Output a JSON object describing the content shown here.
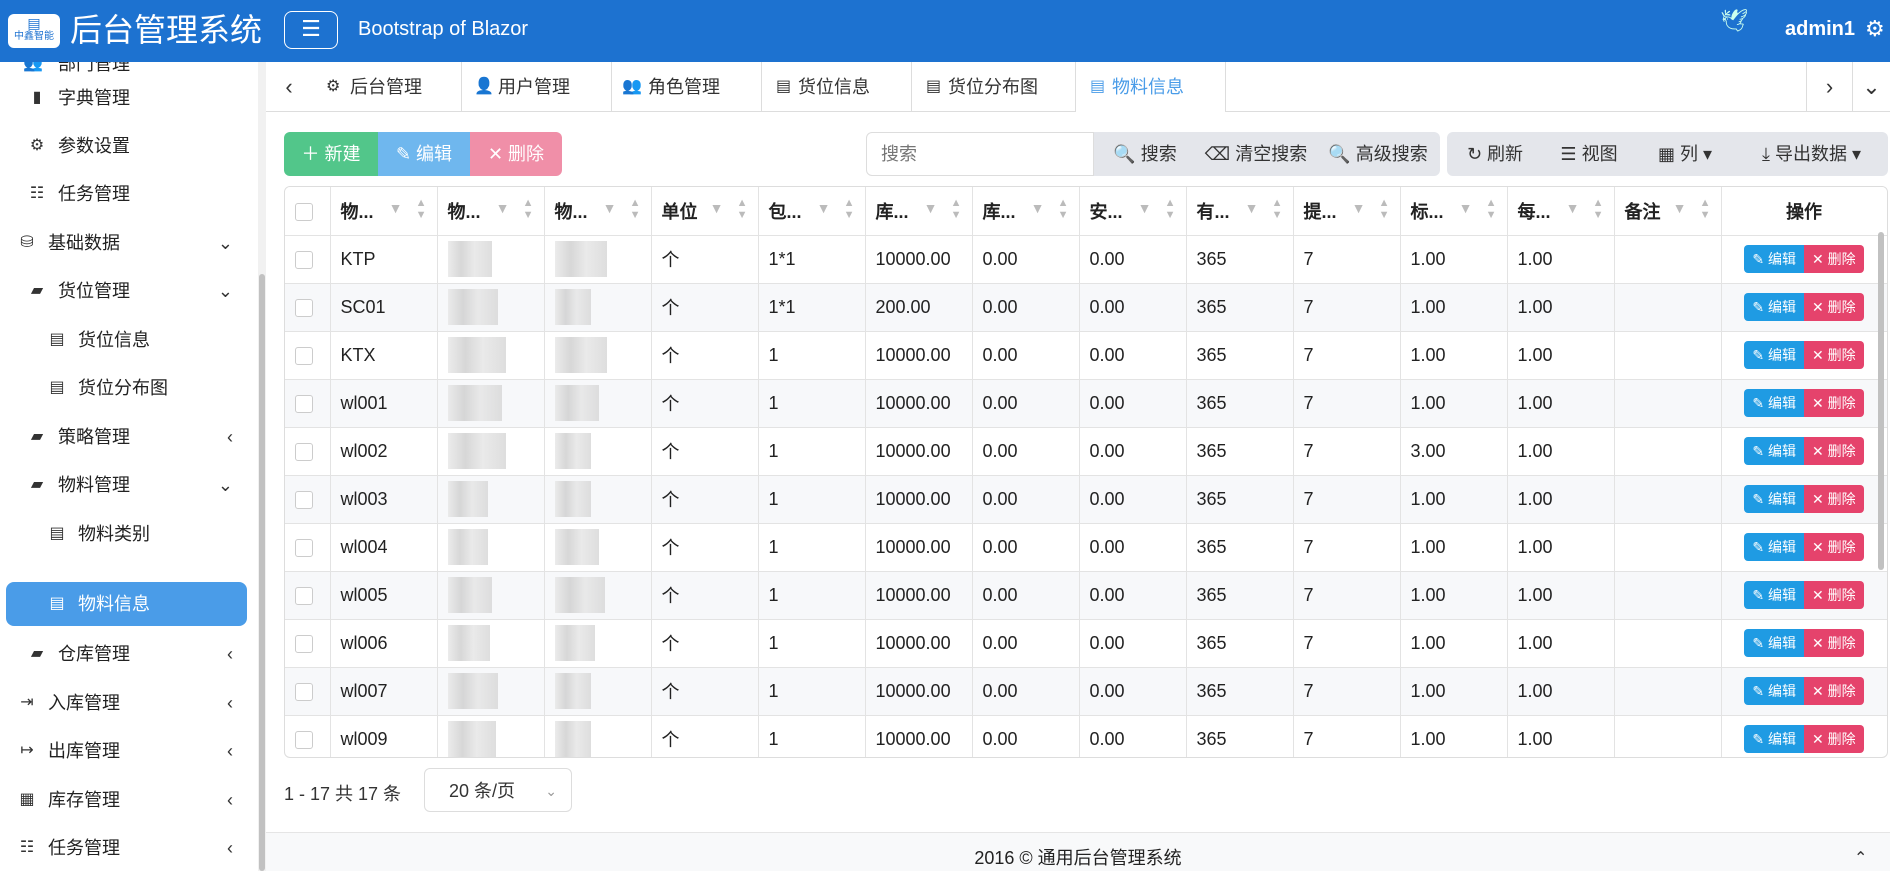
{
  "header": {
    "logo_text": "中鑫智能",
    "app_title": "后台管理系统",
    "menu_icon": "hamburger-icon",
    "brand_subtitle": "Bootstrap of Blazor",
    "user_name": "admin1",
    "settings_icon": "gear-icon"
  },
  "sidebar": {
    "items": [
      {
        "label": "部门管理",
        "icon": "users-icon"
      },
      {
        "label": "字典管理",
        "icon": "book-icon"
      },
      {
        "label": "参数设置",
        "icon": "gears-icon"
      },
      {
        "label": "任务管理",
        "icon": "list-icon"
      },
      {
        "label": "基础数据",
        "icon": "database-icon"
      },
      {
        "label": "货位管理",
        "icon": "folder-icon"
      },
      {
        "label": "货位信息",
        "icon": "file-icon"
      },
      {
        "label": "货位分布图",
        "icon": "file-icon"
      },
      {
        "label": "策略管理",
        "icon": "folder-icon"
      },
      {
        "label": "物料管理",
        "icon": "folder-icon"
      },
      {
        "label": "物料类别",
        "icon": "file-icon"
      },
      {
        "label": "物料信息",
        "icon": "file-icon"
      },
      {
        "label": "仓库管理",
        "icon": "folder-icon"
      },
      {
        "label": "入库管理",
        "icon": "sign-in-icon"
      },
      {
        "label": "出库管理",
        "icon": "sign-out-icon"
      },
      {
        "label": "库存管理",
        "icon": "cubes-icon"
      },
      {
        "label": "任务管理",
        "icon": "list-icon"
      }
    ]
  },
  "tabs": [
    {
      "label": "后台管理",
      "icon": "gear-icon"
    },
    {
      "label": "用户管理",
      "icon": "user-gear-icon"
    },
    {
      "label": "角色管理",
      "icon": "users-icon"
    },
    {
      "label": "货位信息",
      "icon": "file-icon"
    },
    {
      "label": "货位分布图",
      "icon": "file-icon"
    },
    {
      "label": "物料信息",
      "icon": "file-icon"
    }
  ],
  "toolbar": {
    "new_label": "新建",
    "edit_label": "编辑",
    "delete_label": "删除",
    "search_placeholder": "搜索",
    "search_label": "搜索",
    "clear_search_label": "清空搜索",
    "advanced_search_label": "高级搜索",
    "refresh_label": "刷新",
    "view_label": "视图",
    "columns_label": "列",
    "export_label": "导出数据"
  },
  "table": {
    "headers": [
      "物...",
      "物...",
      "物...",
      "单位",
      "包...",
      "库...",
      "库...",
      "安...",
      "有...",
      "提...",
      "标...",
      "每...",
      "备注",
      "操作"
    ],
    "row_edit_label": "编辑",
    "row_delete_label": "删除",
    "rows": [
      {
        "code": "KTP",
        "unit": "个",
        "pack": "1*1",
        "stock": "10000.00",
        "c5": "0.00",
        "c6": "0.00",
        "c7": "365",
        "c8": "7",
        "c9": "1.00",
        "c10": "1.00",
        "note": ""
      },
      {
        "code": "SC01",
        "unit": "个",
        "pack": "1*1",
        "stock": "200.00",
        "c5": "0.00",
        "c6": "0.00",
        "c7": "365",
        "c8": "7",
        "c9": "1.00",
        "c10": "1.00",
        "note": ""
      },
      {
        "code": "KTX",
        "unit": "个",
        "pack": "1",
        "stock": "10000.00",
        "c5": "0.00",
        "c6": "0.00",
        "c7": "365",
        "c8": "7",
        "c9": "1.00",
        "c10": "1.00",
        "note": ""
      },
      {
        "code": "wl001",
        "unit": "个",
        "pack": "1",
        "stock": "10000.00",
        "c5": "0.00",
        "c6": "0.00",
        "c7": "365",
        "c8": "7",
        "c9": "1.00",
        "c10": "1.00",
        "note": ""
      },
      {
        "code": "wl002",
        "unit": "个",
        "pack": "1",
        "stock": "10000.00",
        "c5": "0.00",
        "c6": "0.00",
        "c7": "365",
        "c8": "7",
        "c9": "3.00",
        "c10": "1.00",
        "note": ""
      },
      {
        "code": "wl003",
        "unit": "个",
        "pack": "1",
        "stock": "10000.00",
        "c5": "0.00",
        "c6": "0.00",
        "c7": "365",
        "c8": "7",
        "c9": "1.00",
        "c10": "1.00",
        "note": ""
      },
      {
        "code": "wl004",
        "unit": "个",
        "pack": "1",
        "stock": "10000.00",
        "c5": "0.00",
        "c6": "0.00",
        "c7": "365",
        "c8": "7",
        "c9": "1.00",
        "c10": "1.00",
        "note": ""
      },
      {
        "code": "wl005",
        "unit": "个",
        "pack": "1",
        "stock": "10000.00",
        "c5": "0.00",
        "c6": "0.00",
        "c7": "365",
        "c8": "7",
        "c9": "1.00",
        "c10": "1.00",
        "note": ""
      },
      {
        "code": "wl006",
        "unit": "个",
        "pack": "1",
        "stock": "10000.00",
        "c5": "0.00",
        "c6": "0.00",
        "c7": "365",
        "c8": "7",
        "c9": "1.00",
        "c10": "1.00",
        "note": ""
      },
      {
        "code": "wl007",
        "unit": "个",
        "pack": "1",
        "stock": "10000.00",
        "c5": "0.00",
        "c6": "0.00",
        "c7": "365",
        "c8": "7",
        "c9": "1.00",
        "c10": "1.00",
        "note": ""
      },
      {
        "code": "wl009",
        "unit": "个",
        "pack": "1",
        "stock": "10000.00",
        "c5": "0.00",
        "c6": "0.00",
        "c7": "365",
        "c8": "7",
        "c9": "1.00",
        "c10": "1.00",
        "note": ""
      }
    ]
  },
  "pager": {
    "info": "1 - 17 共 17 条",
    "page_size": "20 条/页"
  },
  "footer": {
    "text": "2016 © 通用后台管理系统"
  }
}
